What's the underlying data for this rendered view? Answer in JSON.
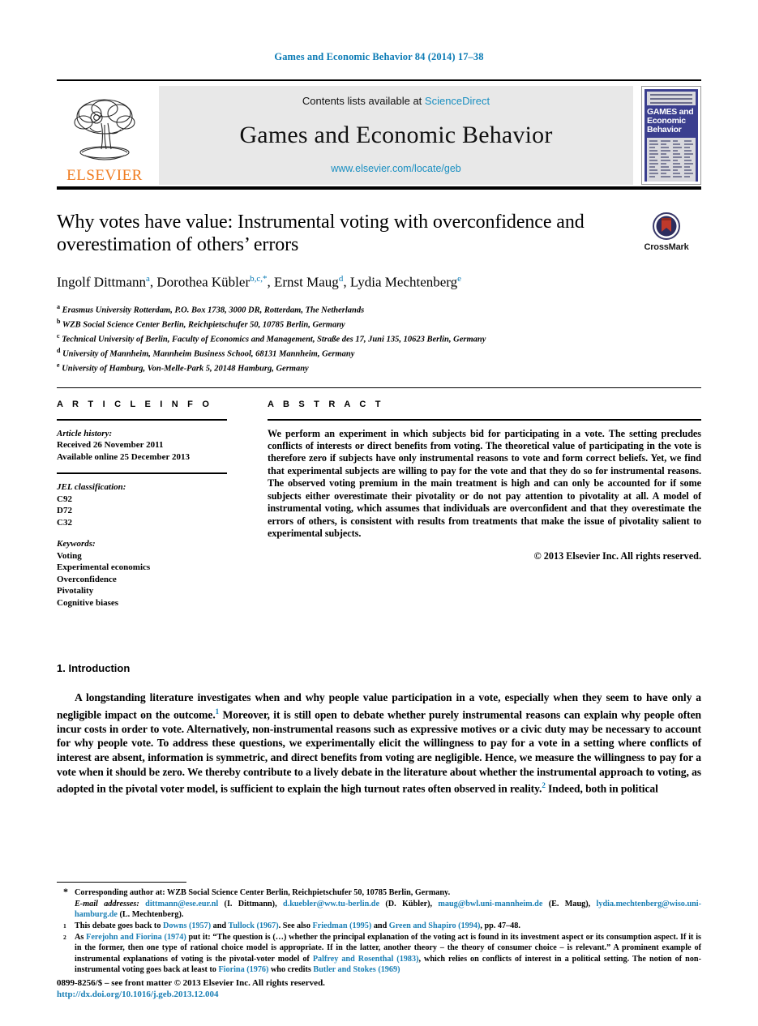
{
  "running_head": "Games and Economic Behavior 84 (2014) 17–38",
  "masthead": {
    "publisher": "ELSEVIER",
    "contents_prefix": "Contents lists available at ",
    "contents_link": "ScienceDirect",
    "journal_title": "Games and Economic Behavior",
    "journal_url": "www.elsevier.com/locate/geb",
    "cover_title_line1": "GAMES and",
    "cover_title_line2": "Economic",
    "cover_title_line3": "Behavior"
  },
  "article": {
    "title": "Why votes have value: Instrumental voting with overconfidence and overestimation of others’ errors",
    "crossmark_label": "CrossMark",
    "authors": [
      {
        "name": "Ingolf Dittmann",
        "sup": "a",
        "sep": ", "
      },
      {
        "name": "Dorothea Kübler",
        "sup": "b,c,*",
        "sep": ", "
      },
      {
        "name": "Ernst Maug",
        "sup": "d",
        "sep": ", "
      },
      {
        "name": "Lydia Mechtenberg",
        "sup": "e",
        "sep": ""
      }
    ],
    "affiliations": [
      {
        "marker": "a",
        "text": "Erasmus University Rotterdam, P.O. Box 1738, 3000 DR, Rotterdam, The Netherlands"
      },
      {
        "marker": "b",
        "text": "WZB Social Science Center Berlin, Reichpietschufer 50, 10785 Berlin, Germany"
      },
      {
        "marker": "c",
        "text": "Technical University of Berlin, Faculty of Economics and Management, Straße des 17, Juni 135, 10623 Berlin, Germany"
      },
      {
        "marker": "d",
        "text": "University of Mannheim, Mannheim Business School, 68131 Mannheim, Germany"
      },
      {
        "marker": "e",
        "text": "University of Hamburg, Von-Melle-Park 5, 20148 Hamburg, Germany"
      }
    ]
  },
  "info": {
    "heading": "A R T I C L E  I N F O",
    "history_label": "Article history:",
    "history": [
      "Received 26 November 2011",
      "Available online 25 December 2013"
    ],
    "jel_label": "JEL classification:",
    "jel": [
      "C92",
      "D72",
      "C32"
    ],
    "keywords_label": "Keywords:",
    "keywords": [
      "Voting",
      "Experimental economics",
      "Overconfidence",
      "Pivotality",
      "Cognitive biases"
    ]
  },
  "abstract": {
    "heading": "A B S T R A C T",
    "text": "We perform an experiment in which subjects bid for participating in a vote. The setting precludes conflicts of interests or direct benefits from voting. The theoretical value of participating in the vote is therefore zero if subjects have only instrumental reasons to vote and form correct beliefs. Yet, we find that experimental subjects are willing to pay for the vote and that they do so for instrumental reasons. The observed voting premium in the main treatment is high and can only be accounted for if some subjects either overestimate their pivotality or do not pay attention to pivotality at all. A model of instrumental voting, which assumes that individuals are overconfident and that they overestimate the errors of others, is consistent with results from treatments that make the issue of pivotality salient to experimental subjects.",
    "copyright": "© 2013 Elsevier Inc. All rights reserved."
  },
  "body": {
    "section_number": "1.",
    "section_title": "Introduction",
    "paragraph_part1": "A longstanding literature investigates when and why people value participation in a vote, especially when they seem to have only a negligible impact on the outcome.",
    "footnote_ref1": "1",
    "paragraph_part2": " Moreover, it is still open to debate whether purely instrumental reasons can explain why people often incur costs in order to vote. Alternatively, non-instrumental reasons such as expressive motives or a civic duty may be necessary to account for why people vote. To address these questions, we experimentally elicit the willingness to pay for a vote in a setting where conflicts of interest are absent, information is symmetric, and direct benefits from voting are negligible. Hence, we measure the willingness to pay for a vote when it should be zero. We thereby contribute to a lively debate in the literature about whether the instrumental approach to voting, as adopted in the pivotal voter model, is sufficient to explain the high turnout rates often observed in reality.",
    "footnote_ref2": "2",
    "paragraph_part3": " Indeed, both in political"
  },
  "footnotes": {
    "corresponding_marker": "*",
    "corresponding": "Corresponding author at: WZB Social Science Center Berlin, Reichpietschufer 50, 10785 Berlin, Germany.",
    "email_label": "E-mail addresses:",
    "emails": [
      {
        "address": "dittmann@ese.eur.nl",
        "who": " (I. Dittmann), "
      },
      {
        "address": "d.kuebler@ww.tu-berlin.de",
        "who": " (D. Kübler), "
      },
      {
        "address": "maug@bwl.uni-mannheim.de",
        "who": " (E. Maug), "
      },
      {
        "address": "lydia.mechtenberg@wiso.uni-hamburg.de",
        "who": " (L. Mechtenberg)."
      }
    ],
    "fn1": {
      "marker": "1",
      "parts": [
        {
          "t": "This debate goes back to ",
          "link": false
        },
        {
          "t": "Downs (1957)",
          "link": true
        },
        {
          "t": " and ",
          "link": false
        },
        {
          "t": "Tullock (1967)",
          "link": true
        },
        {
          "t": ". See also ",
          "link": false
        },
        {
          "t": "Friedman (1995)",
          "link": true
        },
        {
          "t": " and ",
          "link": false
        },
        {
          "t": "Green and Shapiro (1994)",
          "link": true
        },
        {
          "t": ", pp. 47–48.",
          "link": false
        }
      ]
    },
    "fn2": {
      "marker": "2",
      "parts": [
        {
          "t": "As ",
          "link": false
        },
        {
          "t": "Ferejohn and Fiorina (1974)",
          "link": true
        },
        {
          "t": " put it: “The question is (…) whether the principal explanation of the voting act is found in its investment aspect or its consumption aspect. If it is in the former, then one type of rational choice model is appropriate. If in the latter, another theory – the theory of consumer choice – is relevant.” A prominent example of instrumental explanations of voting is the pivotal-voter model of ",
          "link": false
        },
        {
          "t": "Palfrey and Rosenthal (1983)",
          "link": true
        },
        {
          "t": ", which relies on conflicts of interest in a political setting. The notion of non-instrumental voting goes back at least to ",
          "link": false
        },
        {
          "t": "Fiorina (1976)",
          "link": true
        },
        {
          "t": " who credits ",
          "link": false
        },
        {
          "t": "Butler and Stokes (1969)",
          "link": true
        }
      ]
    }
  },
  "footer": {
    "issn_line": "0899-8256/$ – see front matter © 2013 Elsevier Inc. All rights reserved.",
    "doi": "http://dx.doi.org/10.1016/j.geb.2013.12.004"
  },
  "colors": {
    "link": "#1a7fb5",
    "accent": "#0b7bb5",
    "elsevier_orange": "#f07c20",
    "cover_blue": "#3b3f8f"
  }
}
